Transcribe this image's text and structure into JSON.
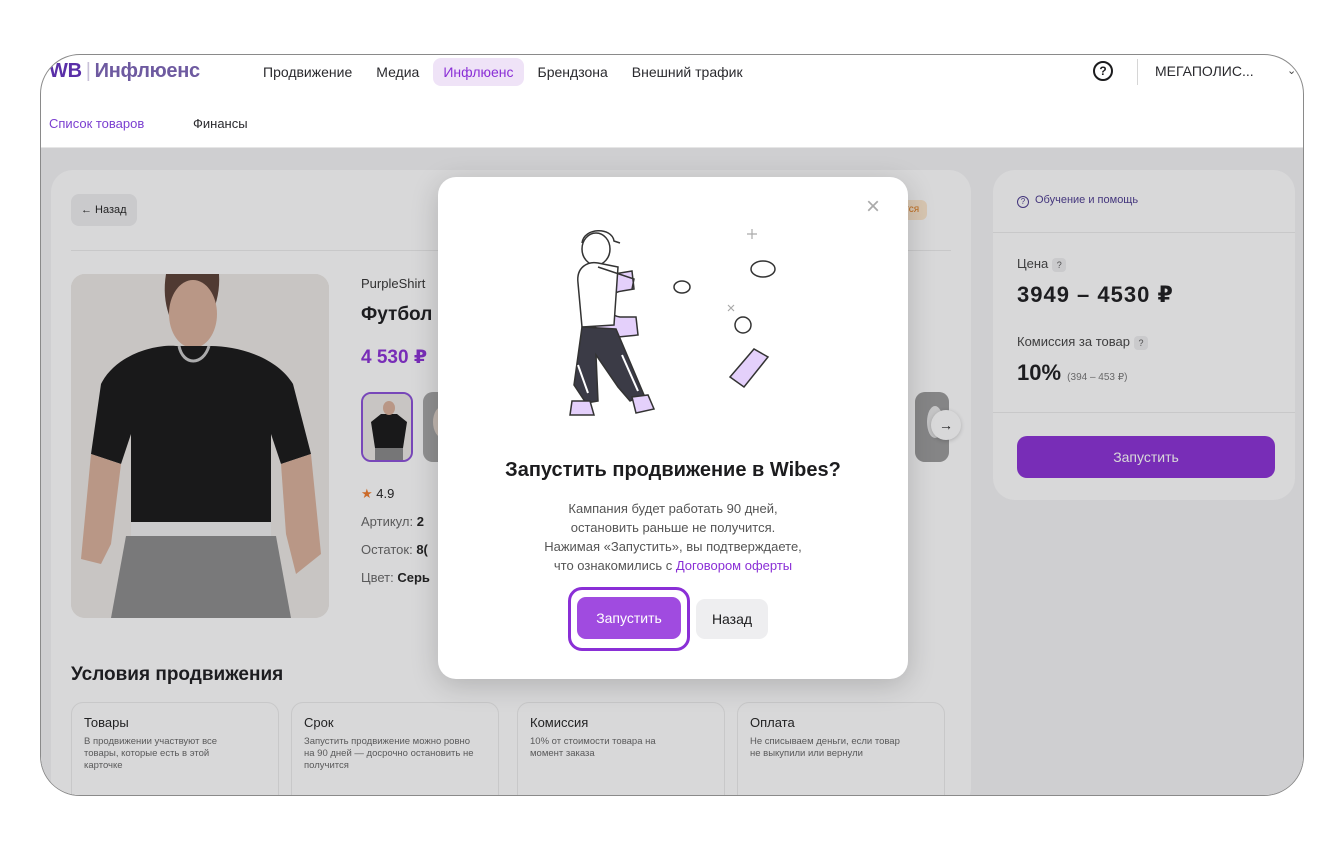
{
  "header": {
    "logo_wb": "WB",
    "logo_brand": "Инфлюенс",
    "nav": [
      "Продвижение",
      "Медиа",
      "Инфлюенс",
      "Брендзона",
      "Внешний трафик"
    ],
    "active_nav": "Инфлюенс",
    "account": "МЕГАПОЛИС...",
    "help_icon": "question-circle-icon"
  },
  "subnav": {
    "items": [
      "Список товаров",
      "Финансы"
    ],
    "active": "Список товаров"
  },
  "product": {
    "back_label": "← Назад",
    "status_tag": "ется",
    "brand": "PurpleShirt",
    "title": "Футбол",
    "price": "4 530 ₽",
    "rating": "4.9",
    "article_label": "Артикул:",
    "article_value": "2",
    "stock_label": "Остаток:",
    "stock_value": "8(",
    "color_label": "Цвет:",
    "color_value": "Серь"
  },
  "conditions": {
    "title": "Условия продвижения",
    "items": [
      {
        "heading": "Товары",
        "text": "В продвижении участвуют все товары, которые есть в этой карточке"
      },
      {
        "heading": "Срок",
        "text": "Запустить продвижение можно ровно на 90 дней — досрочно остановить не получится"
      },
      {
        "heading": "Комиссия",
        "text": "10% от стоимости товара на момент заказа"
      },
      {
        "heading": "Оплата",
        "text": "Не списываем деньги, если товар не выкупили или вернули"
      }
    ]
  },
  "side": {
    "help": "Обучение и помощь",
    "price_label": "Цена",
    "price_value": "3949 – 4530 ₽",
    "commission_label": "Комиссия за товар",
    "commission_value": "10%",
    "commission_range": "(394 – 453 ₽)",
    "launch_label": "Запустить"
  },
  "modal": {
    "title": "Запустить продвижение в Wibes?",
    "text_1": "Кампания будет работать 90 дней,",
    "text_2": "остановить раньше не получится.",
    "text_3": "Нажимая «Запустить», вы подтверждаете,",
    "text_4": "что ознакомились с ",
    "link": "Договором оферты",
    "launch_label": "Запустить",
    "back_label": "Назад",
    "close_icon": "close-icon",
    "illustration": "person-with-magnet-and-coins-illustration"
  },
  "colors": {
    "accent": "#8a2fd6",
    "brand": "#5a2fa8",
    "status": "#e07a1a"
  }
}
